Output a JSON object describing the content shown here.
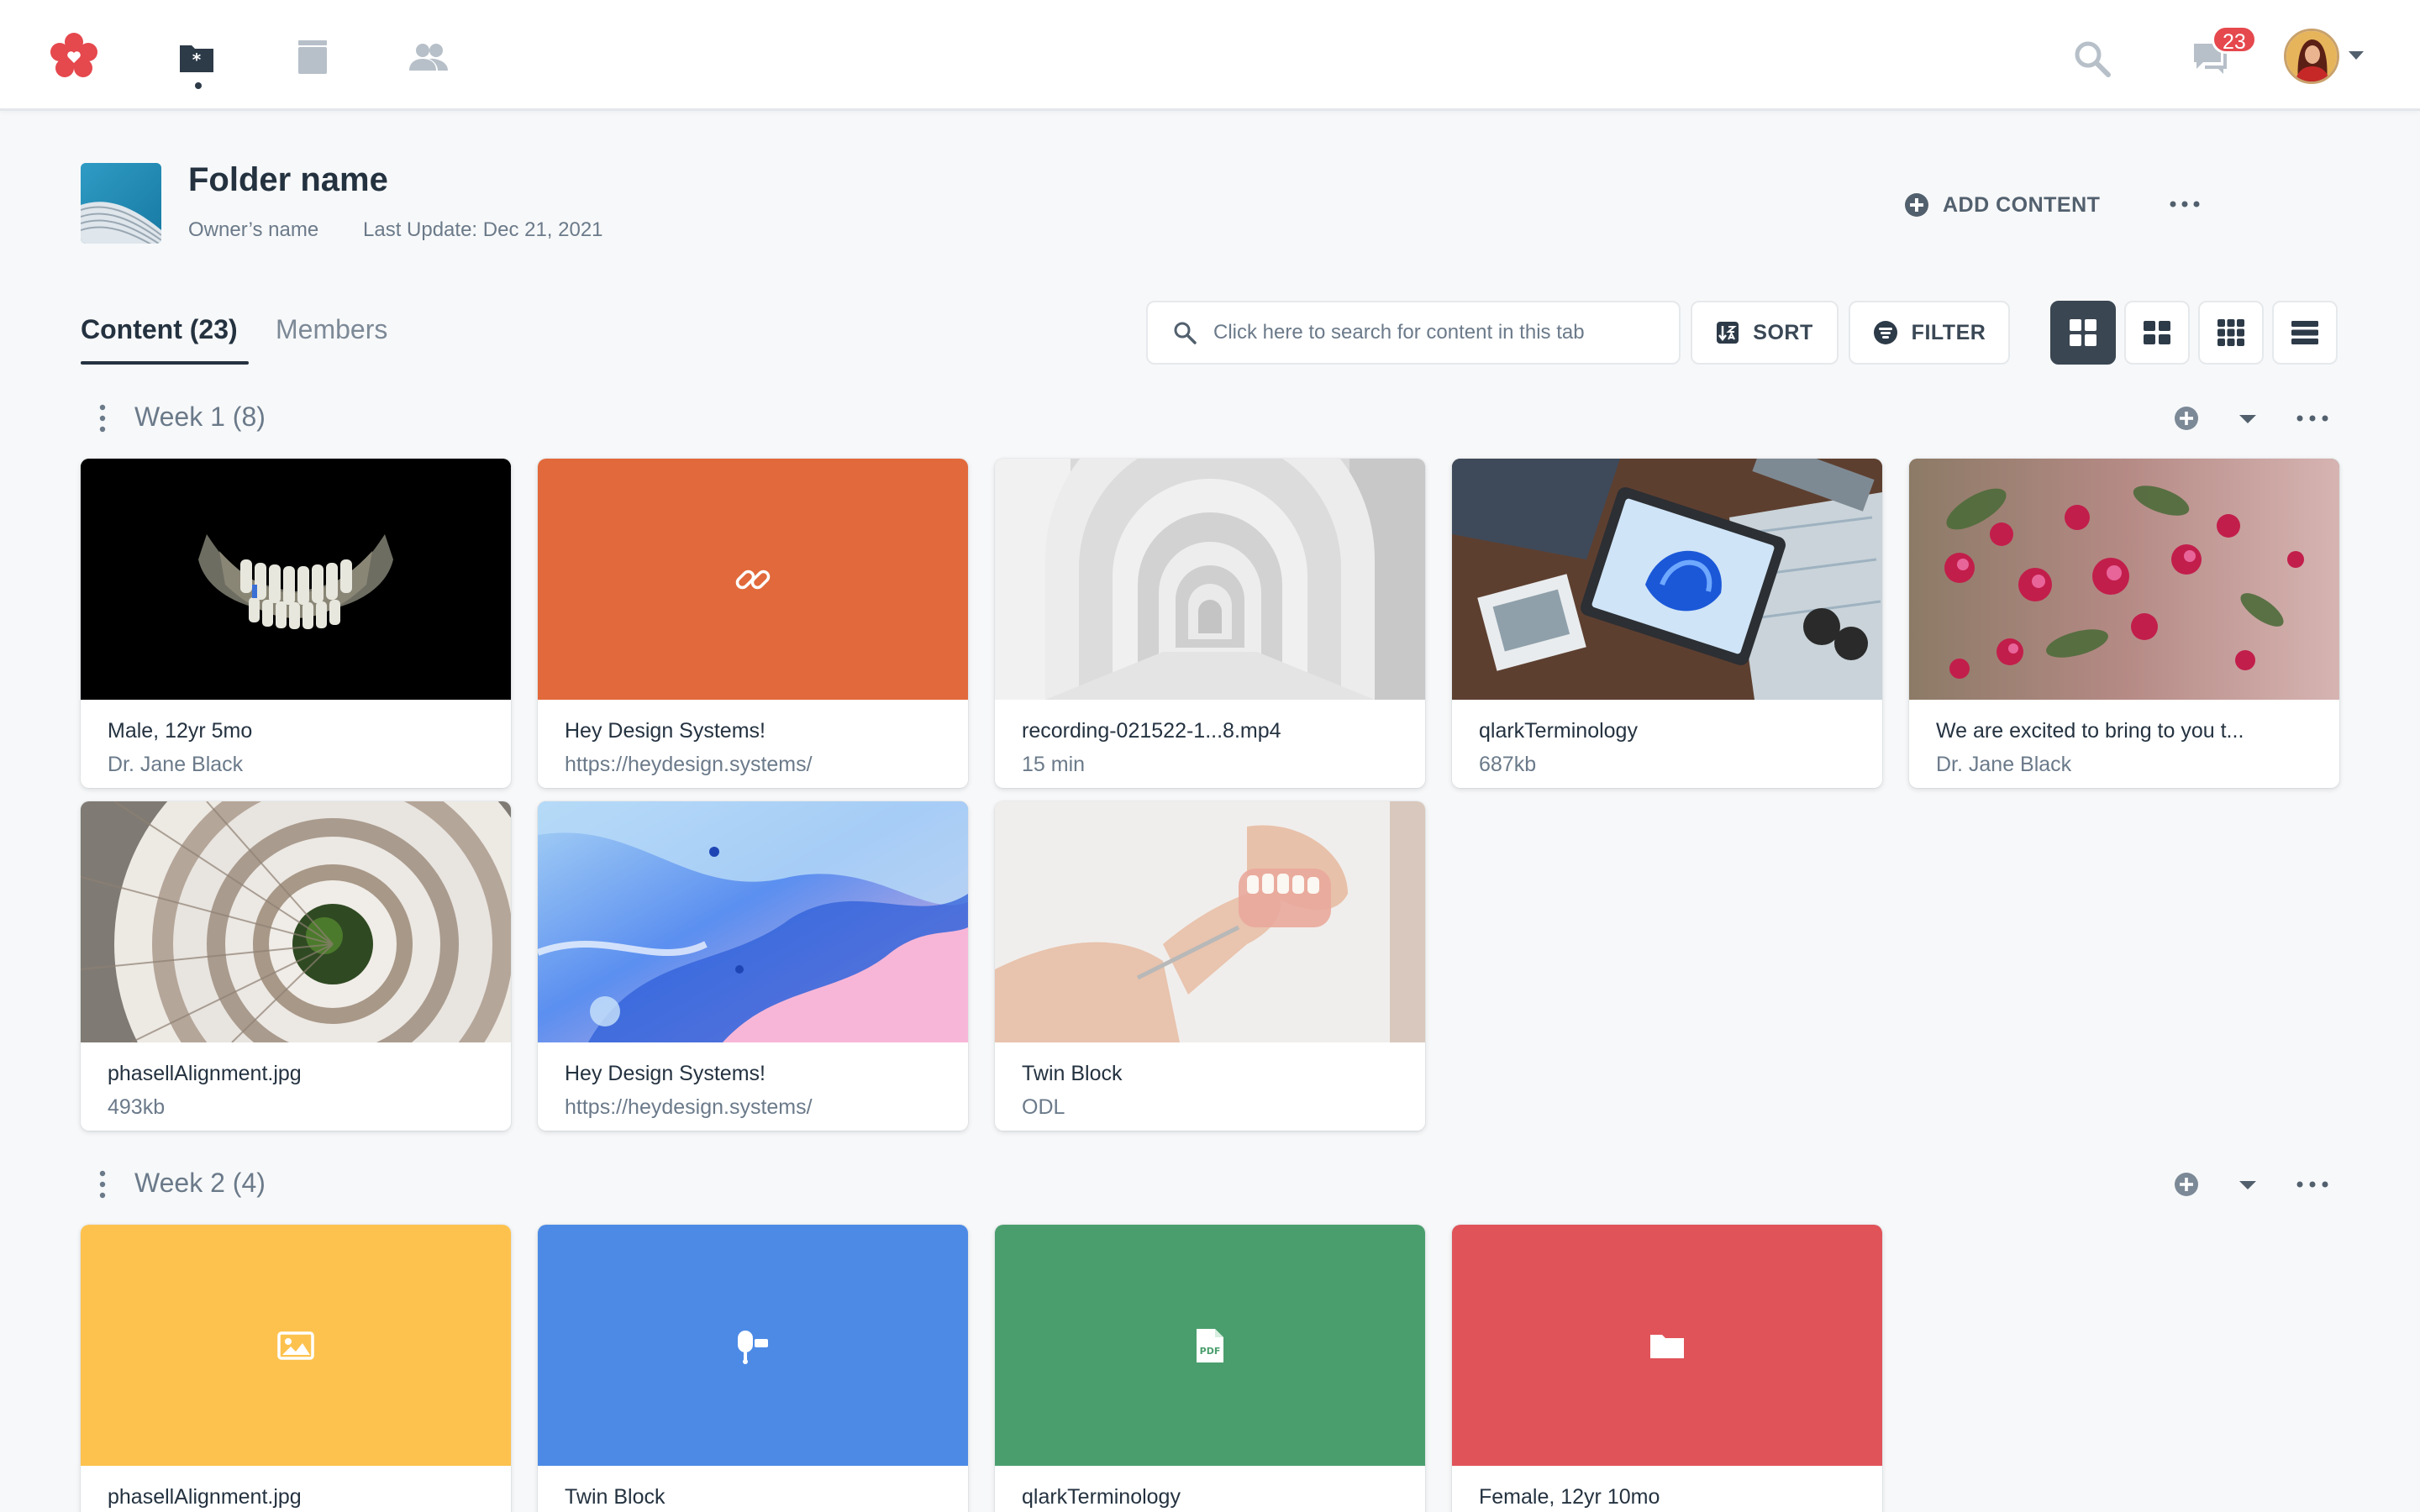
{
  "nav": {
    "logo": "flower-logo",
    "items": [
      {
        "icon": "folder-star-icon",
        "active": true
      },
      {
        "icon": "book-icon"
      },
      {
        "icon": "people-icon"
      }
    ],
    "notification_count": "23"
  },
  "header": {
    "folder_name": "Folder name",
    "owner": "Owner’s name",
    "last_update": "Last Update: Dec 21, 2021",
    "add_content_label": "ADD CONTENT"
  },
  "tabs": [
    {
      "label": "Content (23)",
      "active": true
    },
    {
      "label": "Members",
      "active": false
    }
  ],
  "toolbar": {
    "search_placeholder": "Click here to search for content in this tab",
    "sort_label": "SORT",
    "filter_label": "FILTER",
    "view_modes": [
      "large-grid",
      "medium-grid",
      "small-grid",
      "list"
    ],
    "active_view": "large-grid"
  },
  "sections": [
    {
      "title": "Week 1 (8)",
      "cards": [
        {
          "title": "Male, 12yr 5mo",
          "subtitle": "Dr. Jane Black",
          "media": "dental-scan-image"
        },
        {
          "title": "Hey Design Systems!",
          "subtitle": "https://heydesign.systems/",
          "media": "link-icon",
          "color": "#e1693b"
        },
        {
          "title": "recording-021522-1...8.mp4",
          "subtitle": "15 min",
          "media": "arches-image"
        },
        {
          "title": "qlarkTerminology",
          "subtitle": "687kb",
          "media": "tablet-desk-image"
        },
        {
          "title": "We are excited to bring to you t...",
          "subtitle": "Dr. Jane Black",
          "media": "blossom-image"
        },
        {
          "title": "phasellAlignment.jpg",
          "subtitle": "493kb",
          "media": "spiral-stairs-image"
        },
        {
          "title": "Hey Design Systems!",
          "subtitle": "https://heydesign.systems/",
          "media": "fluid-art-image"
        },
        {
          "title": "Twin Block",
          "subtitle": "ODL",
          "media": "dental-appliance-image"
        }
      ]
    },
    {
      "title": "Week 2 (4)",
      "cards": [
        {
          "title": "phasellAlignment.jpg",
          "media": "image-icon",
          "color": "#fdc24e"
        },
        {
          "title": "Twin Block",
          "media": "appliance-icon",
          "color": "#4c8ae5"
        },
        {
          "title": "qlarkTerminology",
          "media": "pdf-icon",
          "color": "#4a9e6d"
        },
        {
          "title": "Female, 12yr 10mo",
          "media": "folder-icon",
          "color": "#e05359"
        }
      ]
    }
  ]
}
